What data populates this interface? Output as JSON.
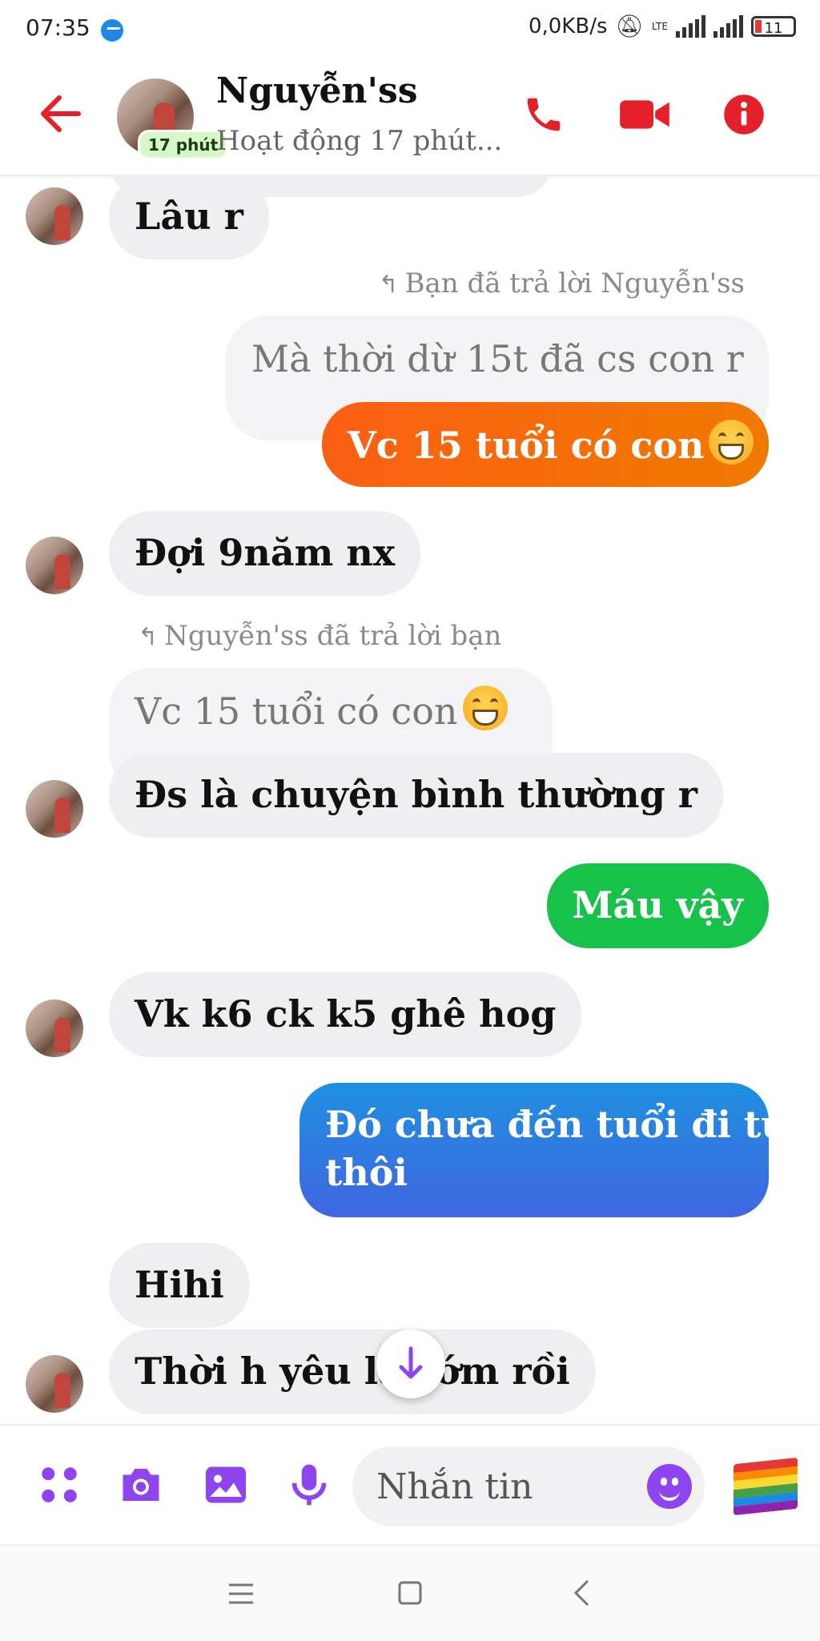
{
  "status_bar": {
    "time": "07:35",
    "speed": "0,0KB/s",
    "network": "LTE",
    "battery": "11"
  },
  "header": {
    "contact_name": "Nguyễn'ss",
    "active_badge": "17 phút",
    "status": "Hoạt động 17 phút..."
  },
  "messages": {
    "m1": "Lâu r",
    "reply_note_1": "Bạn đã trả lời Nguyễn'ss",
    "quoted_1": "Mà thời dừ 15t đã cs con r",
    "m2": "Vc 15 tuổi  có con",
    "m3": "Đợi 9năm nx",
    "reply_note_2": "Nguyễn'ss đã trả lời bạn",
    "quoted_2": "Vc 15 tuổi  có con",
    "m4": "Đs là chuyện bình thường r",
    "m5": "Máu vậy",
    "m6": "Vk k6 ck k5 ghê hog",
    "m7_line1": "Đó chưa đến tuổi đi tù",
    "m7_line2": "thôi",
    "m8": "Hihi",
    "m9": "Thời h yêu là sớm rồi"
  },
  "composer": {
    "placeholder": "Nhắn tin"
  },
  "colors": {
    "accent_red": "#e4202a",
    "accent_purple": "#8e44ef",
    "bubble_orange": "#f56a00",
    "bubble_green": "#16c24a",
    "bubble_blue_top": "#1e90e0",
    "bubble_blue_bottom": "#4166e0"
  },
  "icons": {
    "back": "back-arrow-icon",
    "call": "phone-icon",
    "video": "video-camera-icon",
    "info": "info-icon",
    "apps": "apps-grid-icon",
    "camera": "camera-icon",
    "gallery": "image-icon",
    "mic": "microphone-icon",
    "emoji": "emoji-icon",
    "flag": "rainbow-flag-icon",
    "scroll": "arrow-down-icon"
  }
}
